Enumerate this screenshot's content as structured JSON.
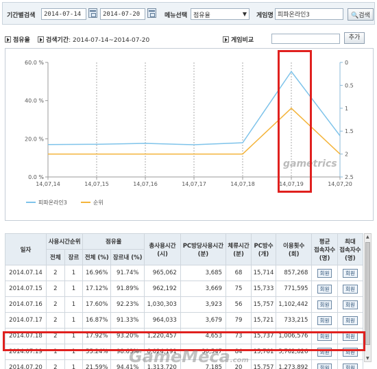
{
  "search": {
    "period_label": "기간별검색",
    "start_date": "2014-07-14",
    "tilde": "~",
    "end_date": "2014-07-20",
    "menu_label": "메뉴선택",
    "menu_value": "점유율",
    "game_label": "게임명",
    "game_value": "피파온라인3",
    "search_button": "검색"
  },
  "section": {
    "share_title": "점유율",
    "period_title": "검색기간",
    "period_value": ": 2014-07-14~2014-07-20",
    "compare_title": "게임비교",
    "add_button": "추가"
  },
  "chart_data": {
    "type": "line",
    "x": [
      "14,07,14",
      "14,07,15",
      "14,07,16",
      "14,07,17",
      "14,07,18",
      "14,07,19",
      "14,07,20"
    ],
    "y_left_ticks": [
      "60.0 %",
      "40.0 %",
      "20.0 %",
      "0.0 %"
    ],
    "y_right_ticks": [
      "0",
      "0.5",
      "1",
      "1.5",
      "2",
      "2.5"
    ],
    "ylim_left": [
      0,
      60
    ],
    "ylim_right": [
      2.5,
      0
    ],
    "series": [
      {
        "name": "피파온라인3",
        "axis": "left",
        "color": "#7ec3ea",
        "values": [
          16.96,
          17.12,
          17.6,
          16.87,
          17.92,
          55.24,
          21.59
        ]
      },
      {
        "name": "순위",
        "axis": "right",
        "color": "#f4b43a",
        "values": [
          2,
          2,
          2,
          2,
          2,
          1,
          2
        ]
      }
    ],
    "watermark": "gametrics"
  },
  "table": {
    "headers": {
      "date": "일자",
      "usage_rank": "사용시간순위",
      "share": "점유율",
      "total_time": "총사용시간",
      "total_time_unit": "(시)",
      "pc_time": "PC방당사용시간",
      "pc_time_unit": "(분)",
      "stay_time": "체류시간",
      "stay_time_unit": "(분)",
      "pc_count": "PC방수",
      "pc_count_unit": "(개)",
      "usage_count": "이용횟수",
      "usage_count_unit": "(회)",
      "avg_conn": "평균",
      "avg_conn2": "접속자수",
      "avg_conn_unit": "(명)",
      "max_conn": "최대",
      "max_conn2": "접속자수",
      "max_conn_unit": "(명)",
      "overall": "전체",
      "genre": "장르",
      "share_all": "전체 (%)",
      "share_genre": "장르내 (%)"
    },
    "rows": [
      {
        "date": "2014.07.14",
        "overall": "2",
        "genre": "1",
        "share_all": "16.96%",
        "share_genre": "91.74%",
        "total": "965,062",
        "pc_time": "3,685",
        "stay": "68",
        "pcs": "15,714",
        "uses": "857,268",
        "avg": "회원",
        "max": "회원"
      },
      {
        "date": "2014.07.15",
        "overall": "2",
        "genre": "1",
        "share_all": "17.12%",
        "share_genre": "91.89%",
        "total": "962,192",
        "pc_time": "3,669",
        "stay": "75",
        "pcs": "15,733",
        "uses": "771,595",
        "avg": "회원",
        "max": "회원"
      },
      {
        "date": "2014.07.16",
        "overall": "2",
        "genre": "1",
        "share_all": "17.60%",
        "share_genre": "92.23%",
        "total": "1,030,303",
        "pc_time": "3,923",
        "stay": "56",
        "pcs": "15,757",
        "uses": "1,102,442",
        "avg": "회원",
        "max": "회원"
      },
      {
        "date": "2014.07.17",
        "overall": "2",
        "genre": "1",
        "share_all": "16.87%",
        "share_genre": "91.33%",
        "total": "964,033",
        "pc_time": "3,679",
        "stay": "79",
        "pcs": "15,721",
        "uses": "733,215",
        "avg": "회원",
        "max": "회원"
      },
      {
        "date": "2014.07.18",
        "overall": "2",
        "genre": "1",
        "share_all": "17.92%",
        "share_genre": "93.20%",
        "total": "1,220,457",
        "pc_time": "4,653",
        "stay": "73",
        "pcs": "15,737",
        "uses": "1,006,576",
        "avg": "회원",
        "max": "회원"
      },
      {
        "date": "2014.07.19",
        "overall": "1",
        "genre": "1",
        "share_all": "55.24%",
        "share_genre": "98.63%",
        "total": "8,024,191",
        "pc_time": "30,547",
        "stay": "84",
        "pcs": "15,761",
        "uses": "5,762,826",
        "avg": "회원",
        "max": "회원"
      },
      {
        "date": "2014.07.20",
        "overall": "2",
        "genre": "1",
        "share_all": "21.59%",
        "share_genre": "94.41%",
        "total": "1,313,720",
        "pc_time": "7,185",
        "stay": "20",
        "pcs": "15,757",
        "uses": "1,273,892",
        "avg": "회원",
        "max": "회원"
      }
    ]
  },
  "watermarks": {
    "bottom": "GameMeca",
    "bottom_suffix": ".com"
  }
}
